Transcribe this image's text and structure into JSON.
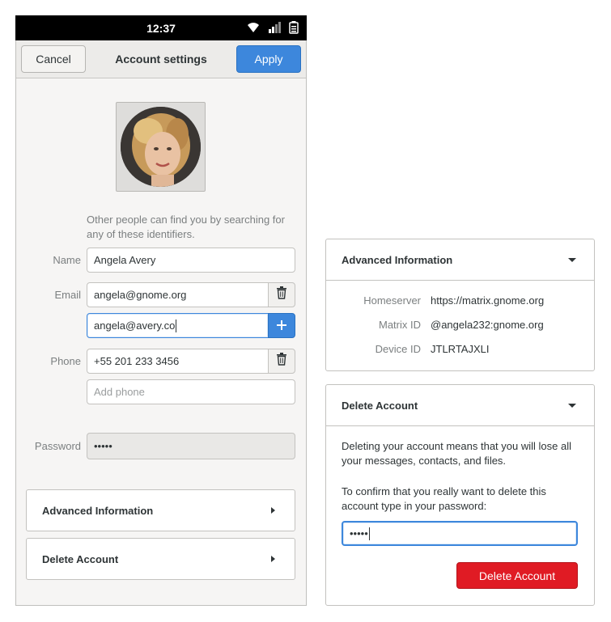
{
  "status": {
    "time": "12:37"
  },
  "header": {
    "cancel_label": "Cancel",
    "title": "Account settings",
    "apply_label": "Apply"
  },
  "form": {
    "hint": "Other people can find you by searching for any of these identifiers.",
    "name_label": "Name",
    "name_value": "Angela Avery",
    "email_label": "Email",
    "email_values": [
      "angela@gnome.org",
      "angela@avery.co"
    ],
    "phone_label": "Phone",
    "phone_value": "+55 201 233 3456",
    "phone_placeholder": "Add phone",
    "password_label": "Password",
    "password_value": "•••••"
  },
  "collapsed": {
    "advanced_title": "Advanced Information",
    "delete_title": "Delete Account"
  },
  "advanced_panel": {
    "title": "Advanced Information",
    "rows": [
      {
        "key": "Homeserver",
        "value": "https://matrix.gnome.org"
      },
      {
        "key": "Matrix ID",
        "value": "@angela232:gnome.org"
      },
      {
        "key": "Device ID",
        "value": "JTLRTAJXLI"
      }
    ]
  },
  "delete_panel": {
    "title": "Delete Account",
    "warning": "Deleting your account means that you will lose all your messages, contacts, and files.",
    "confirm": "To confirm that you really want to delete this account type in your password:",
    "password_value": "•••••",
    "button_label": "Delete Account"
  },
  "colors": {
    "accent": "#3d87dc",
    "danger": "#e01b24",
    "statusbar": "#000000"
  },
  "icons": [
    "wifi-icon",
    "signal-icon",
    "battery-icon",
    "trash-icon",
    "plus-icon",
    "expand-arrow-icon",
    "collapse-arrow-icon"
  ]
}
